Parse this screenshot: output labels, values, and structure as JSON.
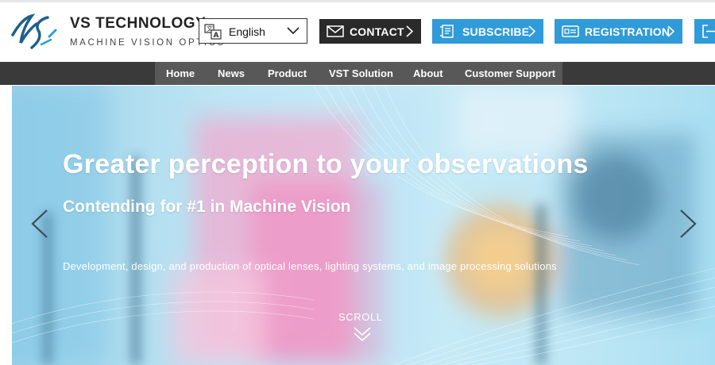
{
  "brand": {
    "name": "VS TECHNOLOGY",
    "tagline": "MACHINE VISION OPTICS",
    "logo_icon": "vs-monogram-icon"
  },
  "header": {
    "language": {
      "selected": "English",
      "icon": "translate-icon"
    },
    "buttons": {
      "contact": {
        "label": "CONTACT",
        "icon": "mail-icon"
      },
      "subscribe": {
        "label": "SUBSCRIBE",
        "icon": "newsletter-icon"
      },
      "registration": {
        "label": "REGISTRATION",
        "icon": "id-card-icon"
      },
      "extra": {
        "icon": "login-icon"
      }
    }
  },
  "nav": {
    "items": [
      {
        "label": "Home"
      },
      {
        "label": "News"
      },
      {
        "label": "Product"
      },
      {
        "label": "VST Solution"
      },
      {
        "label": "About"
      },
      {
        "label": "Customer Support"
      }
    ]
  },
  "hero": {
    "title": "Greater perception to your observations",
    "subtitle": "Contending for #1 in Machine Vision",
    "description": "Development, design, and production of optical lenses, lighting systems, and image processing solutions",
    "scroll_label": "SCROLL"
  },
  "colors": {
    "accent_blue": "#2f9bd9",
    "contact_dark": "#2a2a2a",
    "nav_bar": "#3a3a3a",
    "nav_active_band": "#585858"
  }
}
